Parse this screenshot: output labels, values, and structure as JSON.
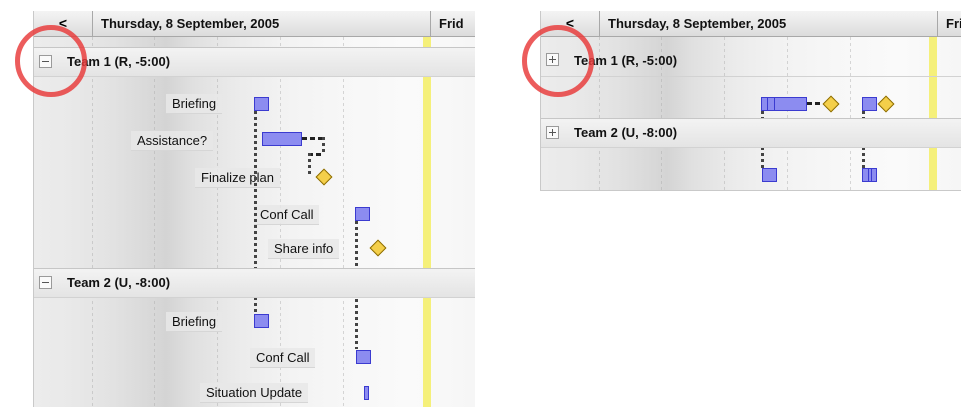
{
  "views": [
    {
      "id": "expanded",
      "nav_left": "<",
      "date_label": "Thursday, 8 September, 2005",
      "next_date_label": "Frid",
      "teams": [
        {
          "name": "Team 1 (R, -5:00)",
          "expanded": true,
          "tasks": [
            {
              "label": "Briefing",
              "type": "task"
            },
            {
              "label": "Assistance?",
              "type": "task"
            },
            {
              "label": "Finalize plan",
              "type": "milestone"
            },
            {
              "label": "Conf Call",
              "type": "task"
            },
            {
              "label": "Share info",
              "type": "milestone"
            }
          ]
        },
        {
          "name": "Team 2 (U, -8:00)",
          "expanded": true,
          "tasks": [
            {
              "label": "Briefing",
              "type": "task"
            },
            {
              "label": "Conf Call",
              "type": "task"
            },
            {
              "label": "Situation Update",
              "type": "task"
            }
          ]
        }
      ]
    },
    {
      "id": "collapsed",
      "nav_left": "<",
      "date_label": "Thursday, 8 September, 2005",
      "next_date_label": "Fri",
      "teams": [
        {
          "name": "Team 1 (R, -5:00)",
          "expanded": false
        },
        {
          "name": "Team 2 (U, -8:00)",
          "expanded": false
        }
      ]
    }
  ],
  "colors": {
    "task_fill": "#8c8cf0",
    "task_border": "#3b3bd0",
    "milestone_fill": "#f4cf4a",
    "today_marker": "#f5f07a",
    "highlight_circle": "#e83838"
  },
  "icons": {
    "collapse": "minus-icon",
    "expand": "plus-icon"
  }
}
